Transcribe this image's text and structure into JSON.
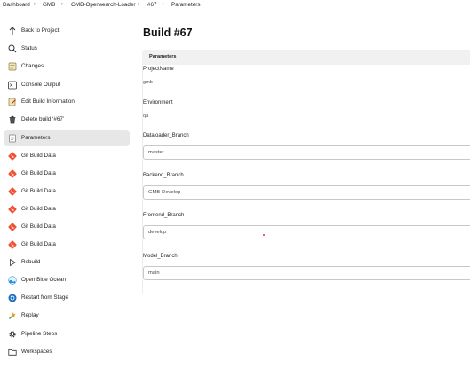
{
  "breadcrumb": [
    "Dashboard",
    "GMB",
    "GMB-Opensearch-Loader",
    "#67",
    "Parameters"
  ],
  "sidebar": {
    "items": [
      {
        "label": "Back to Project",
        "icon": "arrow-up-icon"
      },
      {
        "label": "Status",
        "icon": "search-icon"
      },
      {
        "label": "Changes",
        "icon": "notepad-icon"
      },
      {
        "label": "Console Output",
        "icon": "terminal-icon"
      },
      {
        "label": "Edit Build Information",
        "icon": "notepad-pencil-icon"
      },
      {
        "label": "Delete build ‘#67’",
        "icon": "trash-icon"
      },
      {
        "label": "Parameters",
        "icon": "document-icon",
        "active": true
      },
      {
        "label": "Git Build Data",
        "icon": "git-icon"
      },
      {
        "label": "Git Build Data",
        "icon": "git-icon"
      },
      {
        "label": "Git Build Data",
        "icon": "git-icon"
      },
      {
        "label": "Git Build Data",
        "icon": "git-icon"
      },
      {
        "label": "Git Build Data",
        "icon": "git-icon"
      },
      {
        "label": "Git Build Data",
        "icon": "git-icon"
      },
      {
        "label": "Rebuild",
        "icon": "play-outline-icon"
      },
      {
        "label": "Open Blue Ocean",
        "icon": "blue-ocean-icon"
      },
      {
        "label": "Restart from Stage",
        "icon": "restart-icon"
      },
      {
        "label": "Replay",
        "icon": "replay-icon"
      },
      {
        "label": "Pipeline Steps",
        "icon": "gear-icon"
      },
      {
        "label": "Workspaces",
        "icon": "folder-icon"
      }
    ]
  },
  "main": {
    "title": "Build #67",
    "section_title": "Parameters",
    "params": [
      {
        "name": "ProjectName",
        "value": "gmb"
      },
      {
        "name": "Environment",
        "value": "qa"
      },
      {
        "name": "Dataloader_Branch",
        "value": "master"
      },
      {
        "name": "Backend_Branch",
        "value": "GMB-Develop"
      },
      {
        "name": "Frontend_Branch",
        "value": "develop"
      },
      {
        "name": "Model_Branch",
        "value": "main"
      }
    ]
  },
  "colors": {
    "git": "#f05133",
    "blue_ocean": "#1d8fe0",
    "active_bg": "#e7e7e7",
    "replay": "#e0a020"
  }
}
